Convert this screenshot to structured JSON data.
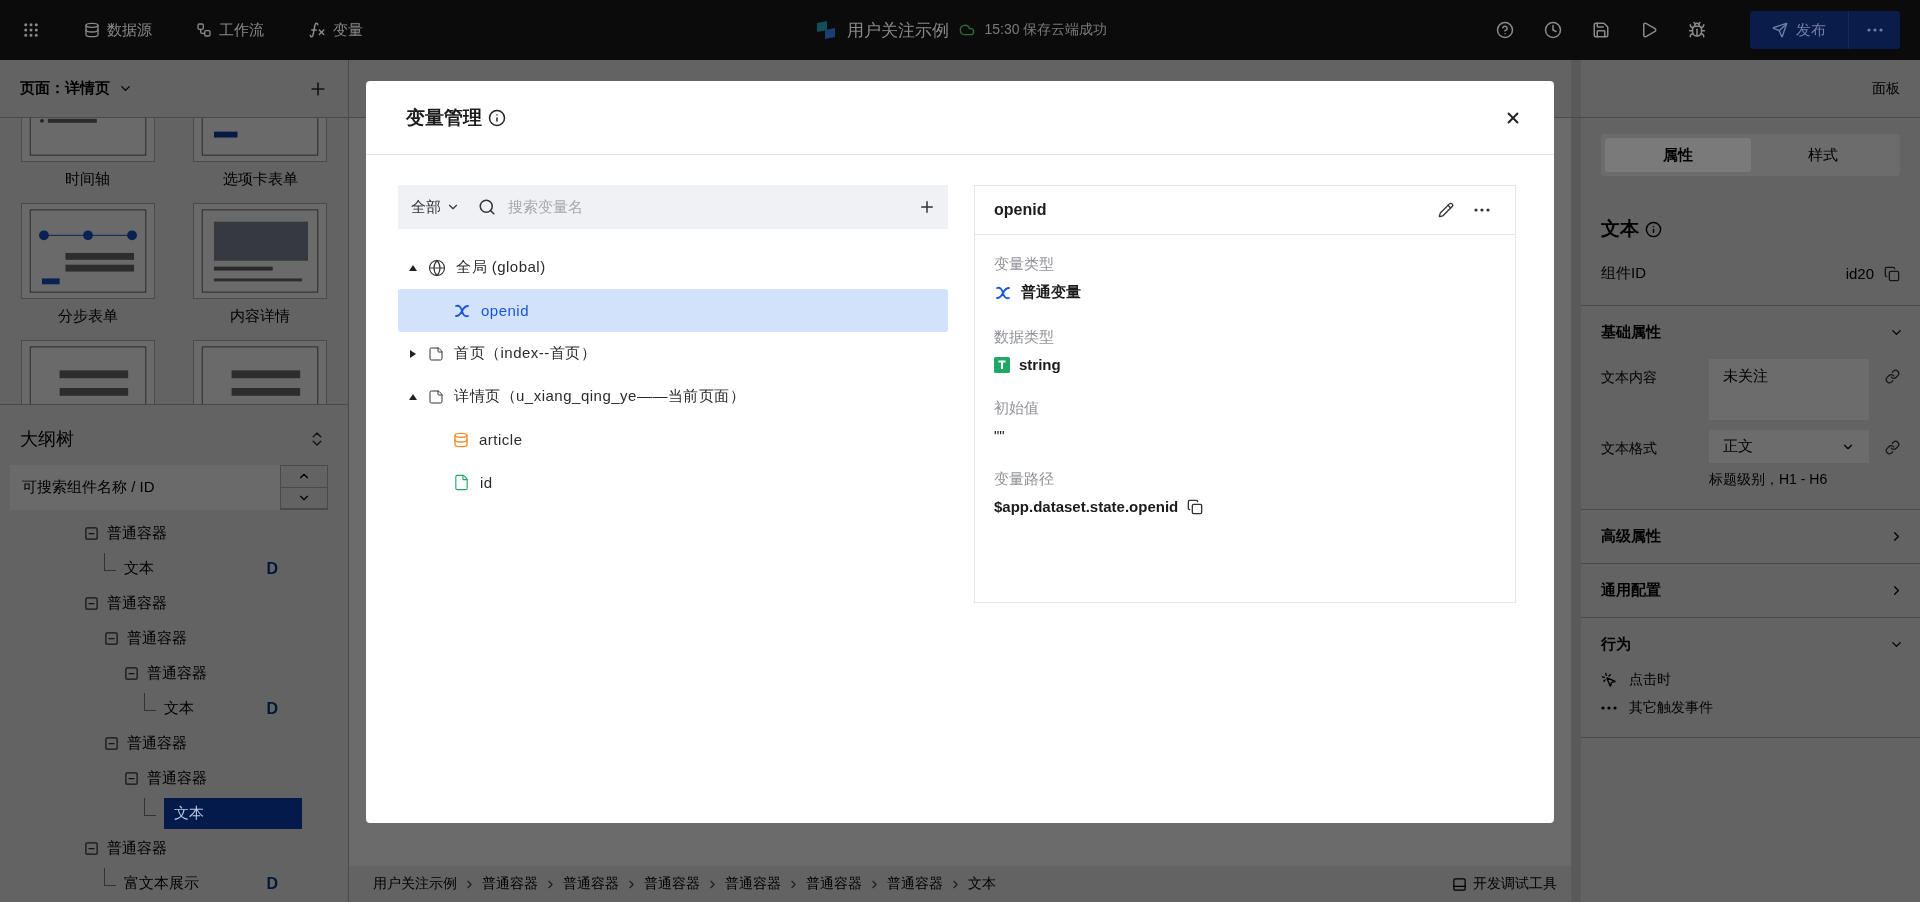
{
  "topbar": {
    "nav": [
      {
        "label": "数据源",
        "kind": "database"
      },
      {
        "label": "工作流",
        "kind": "workflow"
      },
      {
        "label": "变量",
        "kind": "function"
      }
    ],
    "app_title": "用户关注示例",
    "save_status": "15:30 保存云端成功",
    "publish": "发布"
  },
  "left_panel": {
    "page_selector": "页面：详情页",
    "templates": [
      {
        "label": "时间轴",
        "kind": "timeline"
      },
      {
        "label": "选项卡表单",
        "kind": "tabform"
      },
      {
        "label": "分步表单",
        "kind": "steps"
      },
      {
        "label": "内容详情",
        "kind": "content"
      },
      {
        "kind": "form"
      },
      {
        "kind": "form"
      }
    ]
  },
  "outline": {
    "title": "大纲树",
    "search_placeholder": "可搜索组件名称 / ID",
    "tree": [
      {
        "label": "普通容器",
        "selected": false,
        "children": [
          {
            "label": "文本",
            "badge": "D",
            "selected": false
          }
        ]
      },
      {
        "label": "普通容器",
        "selected": false,
        "children": [
          {
            "label": "普通容器",
            "selected": false,
            "children": [
              {
                "label": "普通容器",
                "selected": false,
                "children": [
                  {
                    "label": "文本",
                    "badge": "D",
                    "selected": false
                  }
                ]
              }
            ]
          },
          {
            "label": "普通容器",
            "selected": false,
            "children": [
              {
                "label": "普通容器",
                "selected": false,
                "children": [
                  {
                    "label": "文本",
                    "selected": true
                  }
                ]
              }
            ]
          }
        ]
      },
      {
        "label": "普通容器",
        "selected": false,
        "children": [
          {
            "label": "富文本展示",
            "badge": "D",
            "selected": false
          }
        ]
      }
    ]
  },
  "center": {
    "breadcrumb": [
      "用户关注示例",
      "普通容器",
      "普通容器",
      "普通容器",
      "普通容器",
      "普通容器",
      "普通容器",
      "文本"
    ],
    "devtools": "开发调试工具"
  },
  "right_panel": {
    "panel_label": "面板",
    "tabs": [
      {
        "label": "属性",
        "selected": true
      },
      {
        "label": "样式",
        "selected": false
      }
    ],
    "component": {
      "title": "文本",
      "id_label": "组件ID",
      "id_value": "id20"
    },
    "sections": [
      {
        "title": "基础属性",
        "expanded": true,
        "fields": [
          {
            "label": "文本内容",
            "kind": "textarea",
            "value": "未关注"
          },
          {
            "label": "文本格式",
            "kind": "select",
            "value": "正文",
            "hint": "标题级别，H1 - H6"
          }
        ]
      },
      {
        "title": "高级属性",
        "expanded": false
      },
      {
        "title": "通用配置",
        "expanded": false
      },
      {
        "title": "行为",
        "expanded": true,
        "events": [
          {
            "label": "点击时",
            "kind": "click"
          },
          {
            "label": "其它触发事件",
            "kind": "more"
          }
        ]
      }
    ]
  },
  "modal": {
    "title": "变量管理",
    "filter": "全部",
    "search_placeholder": "搜索变量名",
    "tree": [
      {
        "label": "全局 (global)",
        "kind": "global",
        "expanded": true,
        "selected": false,
        "children": [
          {
            "label": "openid",
            "kind": "variable",
            "selected": true
          }
        ]
      },
      {
        "label": "首页（index--首页）",
        "kind": "page",
        "expanded": false,
        "selected": false
      },
      {
        "label": "详情页（u_xiang_qing_ye——当前页面）",
        "kind": "page",
        "expanded": true,
        "selected": false,
        "children": [
          {
            "label": "article",
            "kind": "dataset",
            "selected": false
          },
          {
            "label": "id",
            "kind": "param",
            "selected": false
          }
        ]
      }
    ],
    "detail": {
      "name": "openid",
      "fields": [
        {
          "label": "变量类型",
          "value": "普通变量",
          "kind": "variable"
        },
        {
          "label": "数据类型",
          "value": "string",
          "kind": "string"
        },
        {
          "label": "初始值",
          "value": "\"\"",
          "kind": "plain"
        },
        {
          "label": "变量路径",
          "value": "$app.dataset.state.openid",
          "kind": "path"
        }
      ]
    }
  }
}
